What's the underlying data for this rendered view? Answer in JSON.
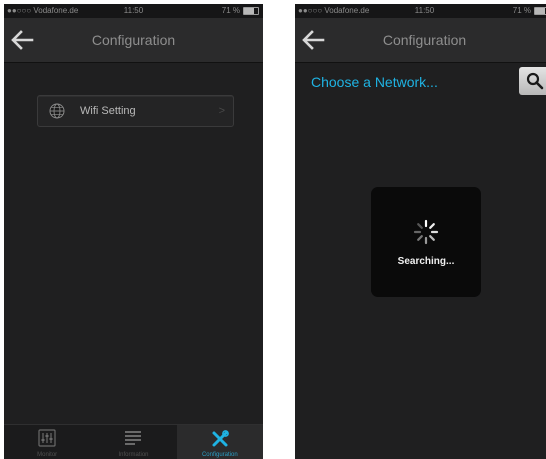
{
  "left_screen": {
    "status": {
      "carrier": "●●○○○ Vodafone.de",
      "time": "11:50",
      "battery": "71 %"
    },
    "navbar": {
      "title": "Configuration"
    },
    "row": {
      "label": "Wifi Setting",
      "chevron": ">"
    },
    "tabs": [
      {
        "label": "Monitor",
        "icon": "equalizer-icon",
        "active": false
      },
      {
        "label": "Information",
        "icon": "information-icon",
        "active": false
      },
      {
        "label": "Configuration",
        "icon": "tools-icon",
        "active": true
      }
    ]
  },
  "right_screen": {
    "status": {
      "carrier": "●●○○○ Vodafone.de",
      "time": "11:50",
      "battery": "71 %"
    },
    "navbar": {
      "title": "Configuration"
    },
    "choose_label": "Choose a Network...",
    "hud": {
      "text": "Searching..."
    }
  },
  "colors": {
    "accent": "#1fb3e3",
    "background": "#1f1f20",
    "navbar": "#2b2b2c"
  }
}
